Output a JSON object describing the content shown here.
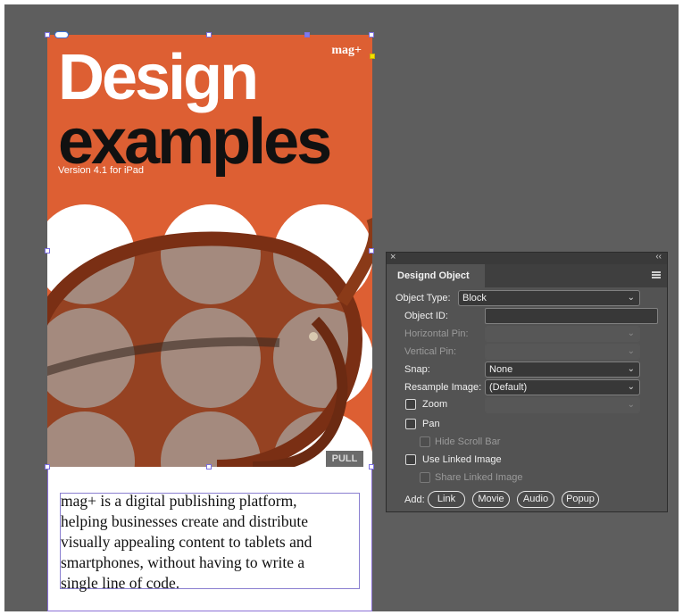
{
  "cover": {
    "title_line1": "Design",
    "title_line2": "examples",
    "subtitle": "Version 4.1 for iPad",
    "logo": "mag+",
    "pull_label": "PULL",
    "colors": {
      "background": "#dd5f33",
      "dots": "#ffffff"
    }
  },
  "body_text": {
    "lines": [
      "mag+ is a digital publishing platform,",
      "helping businesses create and distribute",
      "visually appealing content to tablets and",
      "smartphones, without having to write a",
      "single line of code."
    ]
  },
  "panel": {
    "close_glyph": "×",
    "collapse_glyph": "‹‹",
    "tab_label": "Designd Object",
    "object_type": {
      "label": "Object Type:",
      "value": "Block"
    },
    "object_id": {
      "label": "Object ID:",
      "value": ""
    },
    "horizontal_pin": {
      "label": "Horizontal Pin:",
      "value": ""
    },
    "vertical_pin": {
      "label": "Vertical Pin:",
      "value": ""
    },
    "snap": {
      "label": "Snap:",
      "value": "None"
    },
    "resample_image": {
      "label": "Resample Image:",
      "value": "(Default)"
    },
    "zoom": {
      "label": "Zoom",
      "checked": false
    },
    "pan": {
      "label": "Pan",
      "checked": false
    },
    "hide_scroll_bar": {
      "label": "Hide Scroll Bar",
      "checked": false
    },
    "use_linked_image": {
      "label": "Use Linked Image",
      "checked": false
    },
    "share_linked_image": {
      "label": "Share Linked Image",
      "checked": false
    },
    "add_label": "Add:",
    "add_buttons": [
      "Link",
      "Movie",
      "Audio",
      "Popup"
    ],
    "chevron_glyph": "⌄"
  },
  "colors": {
    "pasteboard": "#5e5e5e",
    "selection": "#7b6fe0",
    "panel_bg": "#535353"
  }
}
